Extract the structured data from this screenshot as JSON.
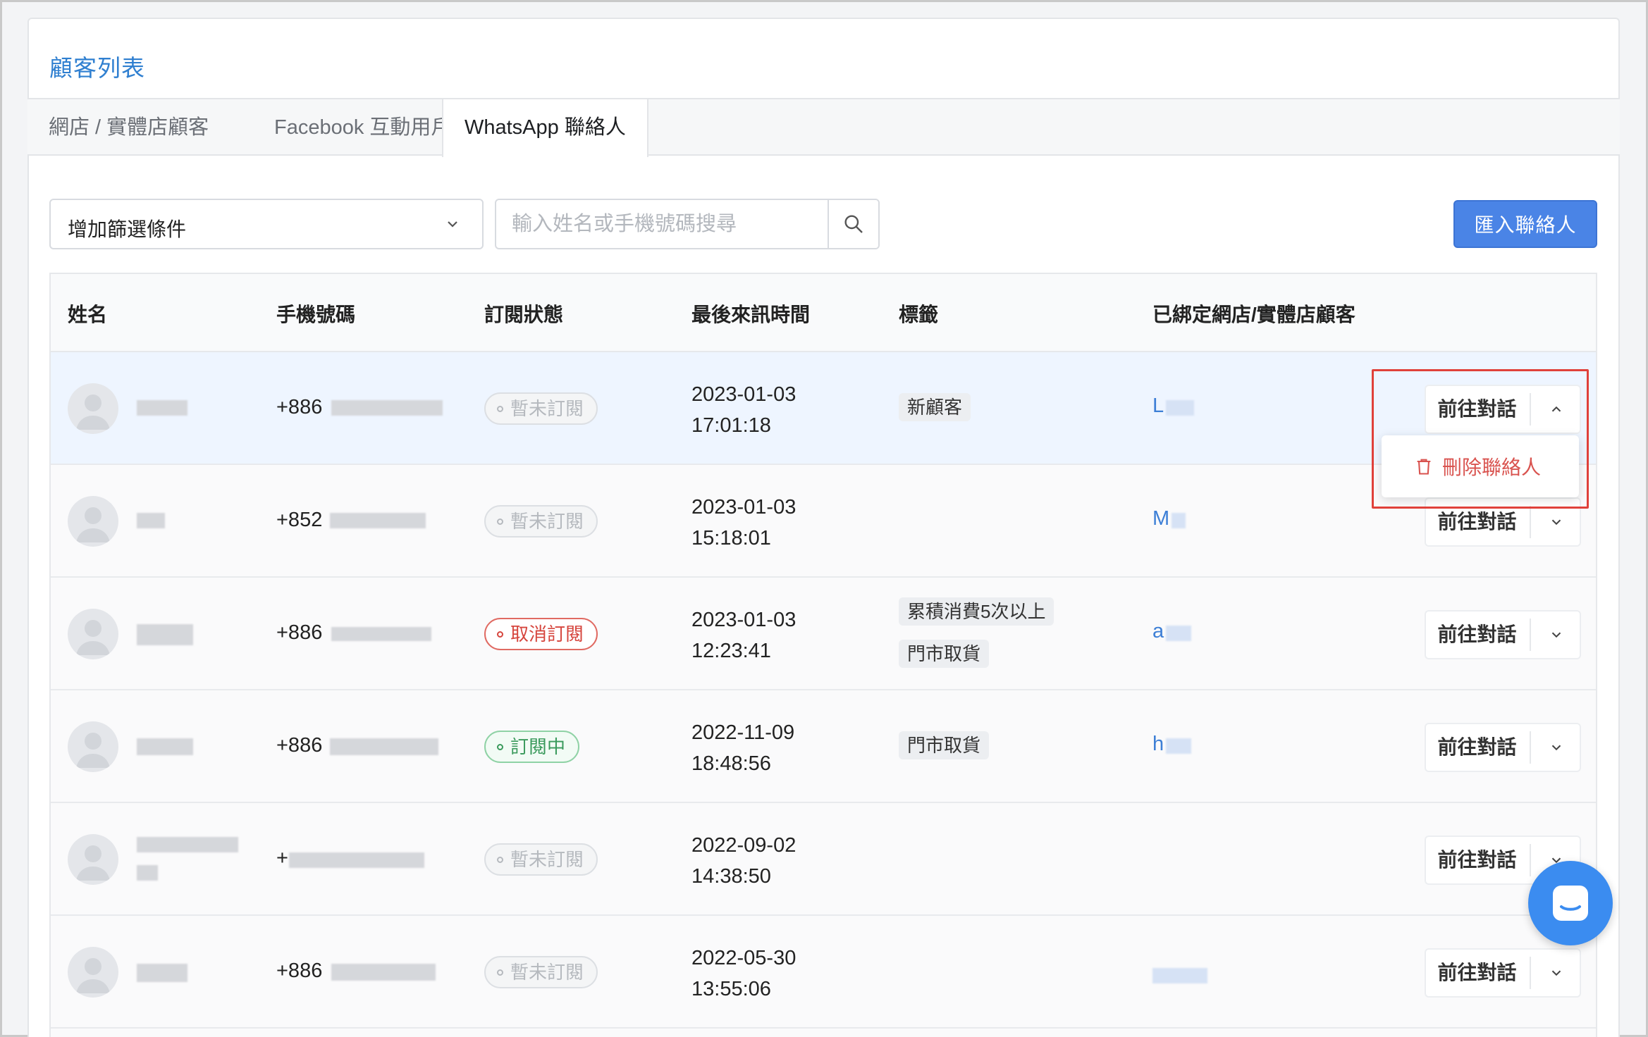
{
  "page": {
    "title": "顧客列表"
  },
  "tabs": [
    {
      "label": "網店 / 實體店顧客",
      "active": false
    },
    {
      "label": "Facebook 互動用戶",
      "active": false
    },
    {
      "label": "WhatsApp 聯絡人",
      "active": true
    }
  ],
  "toolbar": {
    "filter_label": "增加篩選條件",
    "search_placeholder": "輸入姓名或手機號碼搜尋",
    "import_label": "匯入聯絡人"
  },
  "table": {
    "columns": [
      "姓名",
      "手機號碼",
      "訂閱狀態",
      "最後來訊時間",
      "標籤",
      "已綁定網店/實體店顧客"
    ],
    "rows": [
      {
        "phone_prefix": "+886",
        "status": "暫未訂閱",
        "status_type": "none",
        "date": "2023-01-03",
        "time": "17:01:18",
        "tags": [
          "新顧客"
        ],
        "linked": "L",
        "highlight": true
      },
      {
        "phone_prefix": "+852",
        "status": "暫未訂閱",
        "status_type": "none",
        "date": "2023-01-03",
        "time": "15:18:01",
        "tags": [],
        "linked": "M",
        "highlight": false
      },
      {
        "phone_prefix": "+886",
        "status": "取消訂閱",
        "status_type": "cancel",
        "date": "2023-01-03",
        "time": "12:23:41",
        "tags": [
          "累積消費5次以上",
          "門市取貨"
        ],
        "linked": "a",
        "highlight": false
      },
      {
        "phone_prefix": "+886",
        "status": "訂閱中",
        "status_type": "active",
        "date": "2022-11-09",
        "time": "18:48:56",
        "tags": [
          "門市取貨"
        ],
        "linked": "h",
        "highlight": false
      },
      {
        "phone_prefix": "+",
        "status": "暫未訂閱",
        "status_type": "none",
        "date": "2022-09-02",
        "time": "14:38:50",
        "tags": [],
        "linked": "",
        "highlight": false
      },
      {
        "phone_prefix": "+886",
        "status": "暫未訂閱",
        "status_type": "none",
        "date": "2022-05-30",
        "time": "13:55:06",
        "tags": [],
        "linked": "",
        "highlight": false
      }
    ],
    "action_label": "前往對話"
  },
  "dropdown": {
    "delete_label": "刪除聯絡人"
  },
  "colors": {
    "accent": "#4a84e6",
    "link": "#3d7fd6",
    "danger": "#d9534f",
    "success": "#3a9a5c"
  }
}
